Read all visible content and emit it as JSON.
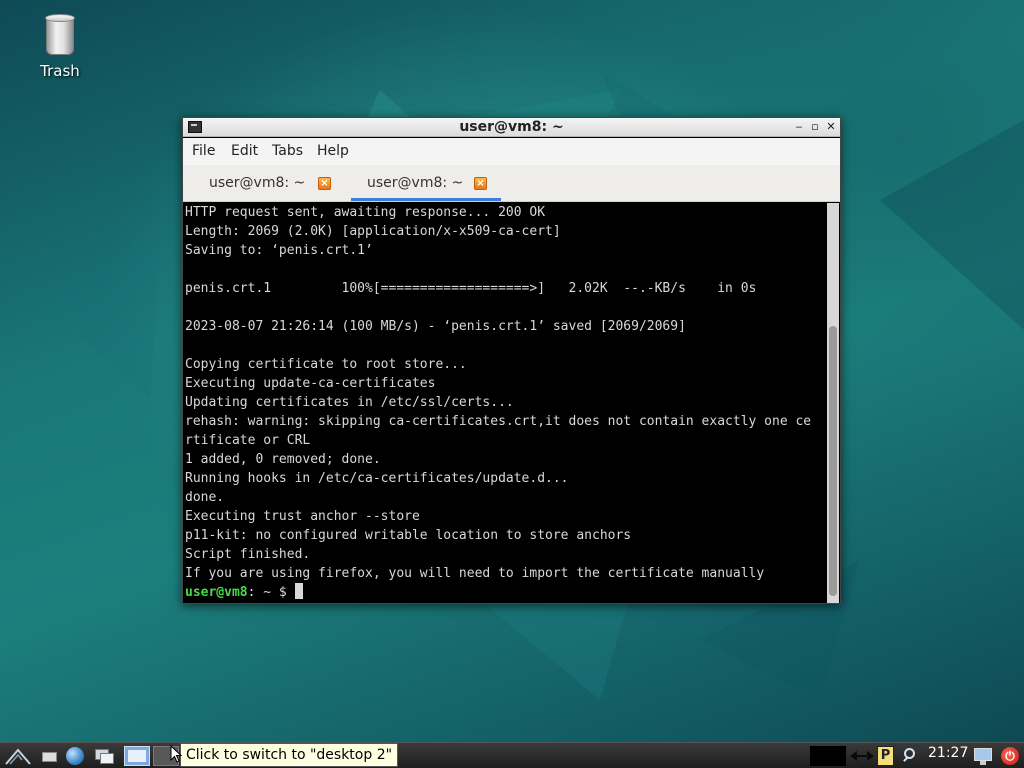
{
  "desktop": {
    "icons": [
      {
        "label": "Trash",
        "icon": "trash-can-icon"
      }
    ]
  },
  "window": {
    "title": "user@vm8: ~",
    "app_icon": "terminal-icon",
    "controls": {
      "minimize": "‒",
      "maximize": "▫",
      "close": "✕"
    },
    "menu": [
      "File",
      "Edit",
      "Tabs",
      "Help"
    ],
    "tabs": [
      {
        "label": "user@vm8: ~",
        "active": false,
        "close_icon": "⨯"
      },
      {
        "label": "user@vm8: ~",
        "active": true,
        "close_icon": "⨯"
      }
    ],
    "accent_color": "#3d7edb"
  },
  "terminal": {
    "lines": [
      "HTTP request sent, awaiting response... 200 OK",
      "Length: 2069 (2.0K) [application/x-x509-ca-cert]",
      "Saving to: ‘penis.crt.1’",
      "",
      "penis.crt.1         100%[===================>]   2.02K  --.-KB/s    in 0s",
      "",
      "2023-08-07 21:26:14 (100 MB/s) - ‘penis.crt.1’ saved [2069/2069]",
      "",
      "Copying certificate to root store...",
      "Executing update-ca-certificates",
      "Updating certificates in /etc/ssl/certs...",
      "rehash: warning: skipping ca-certificates.crt,it does not contain exactly one ce",
      "rtificate or CRL",
      "1 added, 0 removed; done.",
      "Running hooks in /etc/ca-certificates/update.d...",
      "done.",
      "Executing trust anchor --store",
      "p11-kit: no configured writable location to store anchors",
      "Script finished.",
      "If you are using firefox, you will need to import the certificate manually"
    ],
    "prompt_user": "user@vm8",
    "prompt_rest": ": ~ $ ",
    "prompt_color": "#4ad94a"
  },
  "taskbar": {
    "tooltip": "Click to switch to \"desktop 2\"",
    "clock": "21:27",
    "tray_p_label": "P",
    "icons": [
      "start-menu-icon",
      "file-manager-icon",
      "web-browser-icon",
      "windows-icon",
      "desktop-1-icon",
      "desktop-2-icon",
      "pager-p-icon",
      "search-icon",
      "network-icon",
      "power-icon"
    ]
  }
}
